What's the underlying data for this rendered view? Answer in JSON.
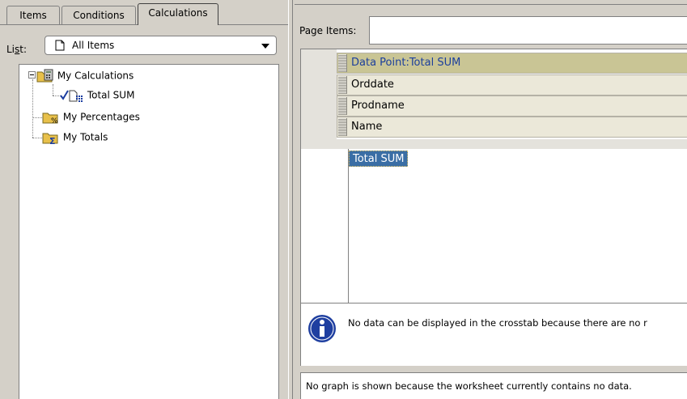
{
  "tabs": [
    {
      "label": "Items",
      "active": false
    },
    {
      "label": "Conditions",
      "active": false
    },
    {
      "label": "Calculations",
      "active": true
    }
  ],
  "list": {
    "label_prefix": "Li",
    "label_underlined": "s",
    "label_suffix": "t:",
    "selected": "All Items"
  },
  "tree": {
    "items": [
      {
        "label": "My Calculations",
        "icon": "folder-calculator-icon",
        "expanded": true
      },
      {
        "label": "Total SUM",
        "icon": "calculation-item-icon",
        "checked": true
      },
      {
        "label": "My Percentages",
        "icon": "folder-percent-icon"
      },
      {
        "label": "My Totals",
        "icon": "folder-sigma-icon"
      }
    ]
  },
  "right": {
    "page_items_label": "Page Items:",
    "headers": [
      "Data Point:Total SUM",
      "Orddate",
      "Prodname",
      "Name"
    ],
    "data_cell": "Total SUM",
    "message": "No data can be displayed in the crosstab because there are no r",
    "graph_message": "No graph is shown because the worksheet currently contains no data."
  },
  "colors": {
    "window_bg": "#d4d0c8",
    "header_selected": "#c9c595",
    "header_row": "#ebe8d9",
    "selection": "#3a6ea5",
    "info_icon": "#1f3fa0"
  }
}
